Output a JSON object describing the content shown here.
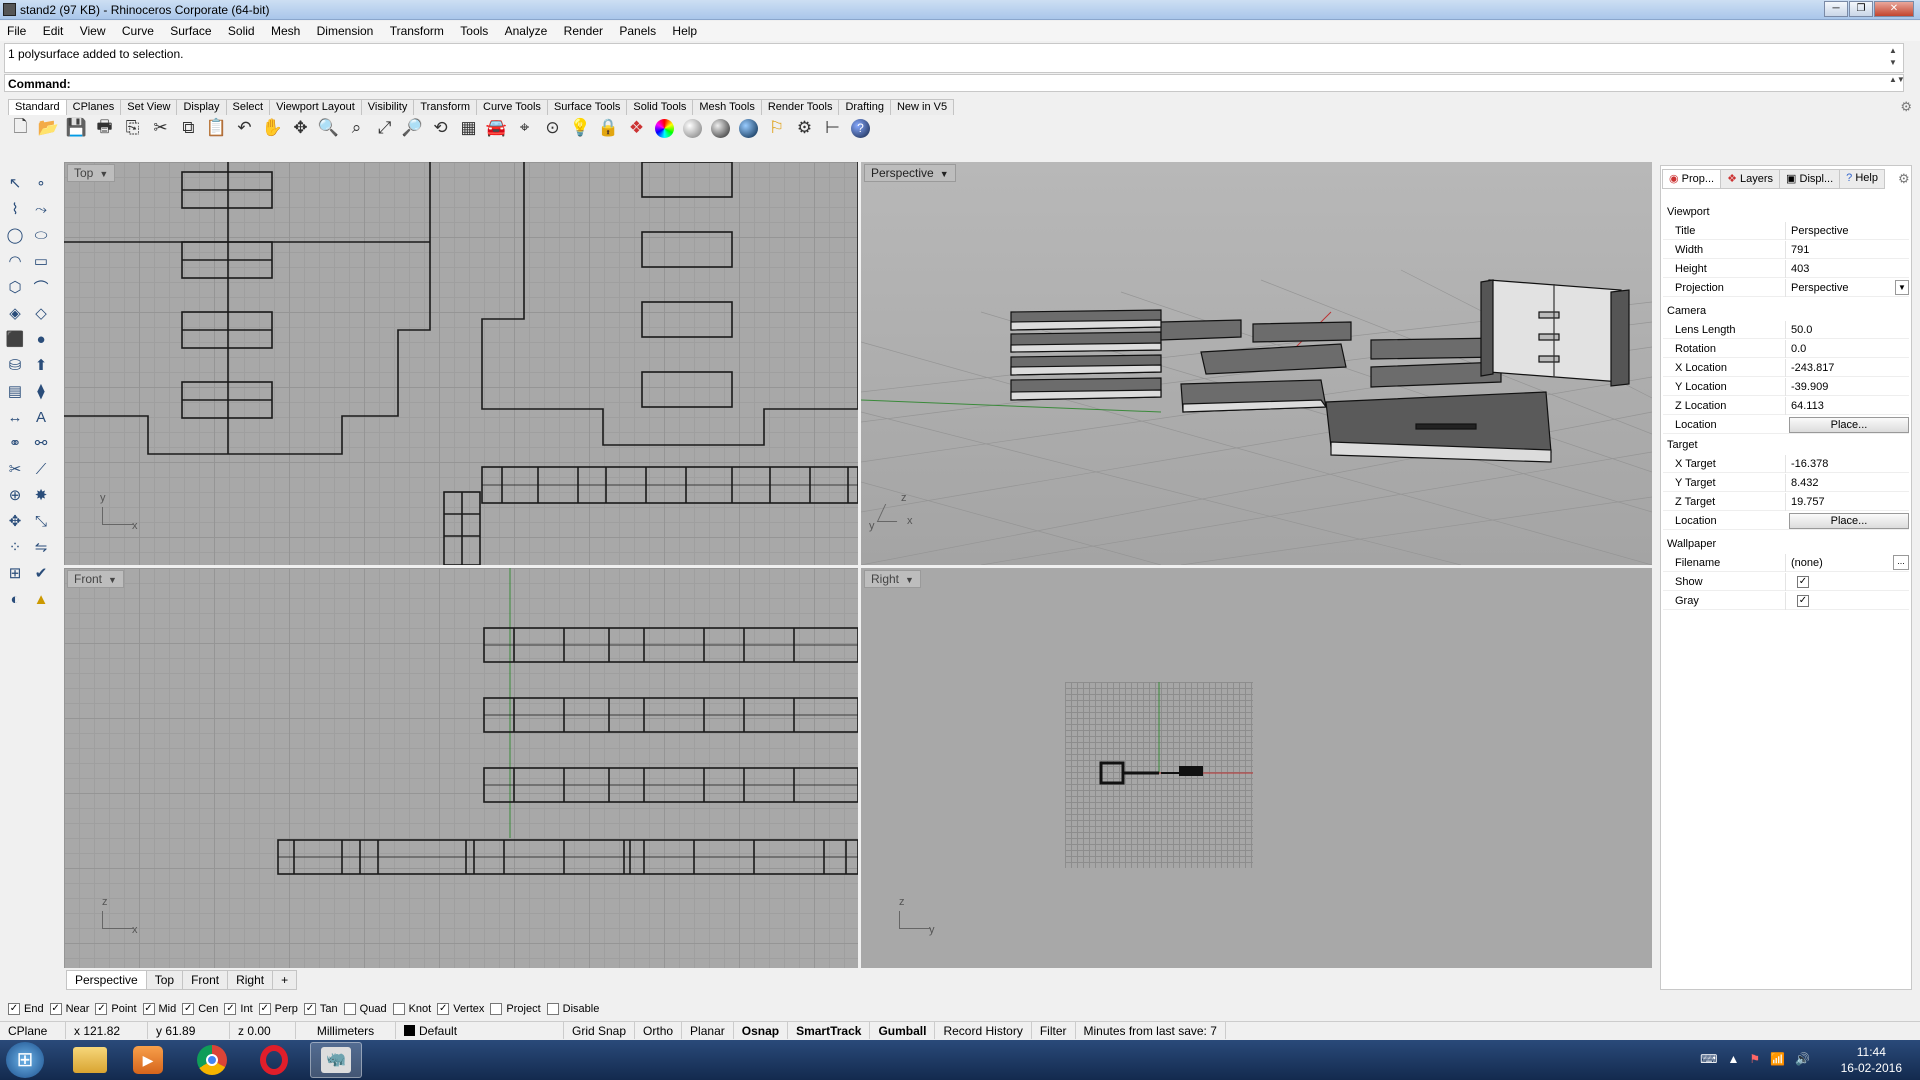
{
  "window": {
    "title": "stand2 (97 KB) - Rhinoceros Corporate (64-bit)",
    "buttons": [
      "─",
      "❐",
      "✕"
    ]
  },
  "menu": [
    "File",
    "Edit",
    "View",
    "Curve",
    "Surface",
    "Solid",
    "Mesh",
    "Dimension",
    "Transform",
    "Tools",
    "Analyze",
    "Render",
    "Panels",
    "Help"
  ],
  "history": {
    "text": "1 polysurface added to selection."
  },
  "command": {
    "label": "Command:"
  },
  "toolbar_tabs": [
    "Standard",
    "CPlanes",
    "Set View",
    "Display",
    "Select",
    "Viewport Layout",
    "Visibility",
    "Transform",
    "Curve Tools",
    "Surface Tools",
    "Solid Tools",
    "Mesh Tools",
    "Render Tools",
    "Drafting",
    "New in V5"
  ],
  "toolbar_icons": [
    "new-icon",
    "open-icon",
    "save-icon",
    "print-icon",
    "import-icon",
    "cut-icon",
    "copy-icon",
    "paste-icon",
    "undo-icon",
    "pan-icon",
    "move-icon",
    "zoom-icon",
    "zoom-window-icon",
    "zoom-extents-icon",
    "zoom-selected-icon",
    "rotate-view-icon",
    "four-view-icon",
    "car-icon",
    "cplane-icon",
    "point-icon",
    "light-icon",
    "lock-icon",
    "layer-icon",
    "color-wheel-icon",
    "shaded-sphere-icon",
    "rendered-sphere-icon",
    "render-sphere-icon",
    "filter-icon",
    "settings-icon",
    "dimension-icon",
    "help-icon"
  ],
  "viewports": {
    "top": {
      "title": "Top",
      "axis_x": "x",
      "axis_y": "y"
    },
    "perspective": {
      "title": "Perspective",
      "axis_x": "x",
      "axis_y": "y",
      "axis_z": "z"
    },
    "front": {
      "title": "Front",
      "axis_x": "x",
      "axis_z": "z"
    },
    "right": {
      "title": "Right",
      "axis_y": "y",
      "axis_z": "z"
    }
  },
  "viewport_tabs": [
    "Perspective",
    "Top",
    "Front",
    "Right",
    "+"
  ],
  "panel": {
    "tabs": [
      "Prop...",
      "Layers",
      "Displ...",
      "Help"
    ],
    "sections": {
      "viewport": "Viewport",
      "camera": "Camera",
      "target": "Target",
      "wallpaper": "Wallpaper"
    },
    "viewport_rows": [
      {
        "key": "Title",
        "value": "Perspective"
      },
      {
        "key": "Width",
        "value": "791"
      },
      {
        "key": "Height",
        "value": "403"
      },
      {
        "key": "Projection",
        "value": "Perspective"
      }
    ],
    "camera_rows": [
      {
        "key": "Lens Length",
        "value": "50.0"
      },
      {
        "key": "Rotation",
        "value": "0.0"
      },
      {
        "key": "X Location",
        "value": "-243.817"
      },
      {
        "key": "Y Location",
        "value": "-39.909"
      },
      {
        "key": "Z Location",
        "value": "64.113"
      }
    ],
    "camera_location": {
      "key": "Location",
      "button": "Place..."
    },
    "target_rows": [
      {
        "key": "X Target",
        "value": "-16.378"
      },
      {
        "key": "Y Target",
        "value": "8.432"
      },
      {
        "key": "Z Target",
        "value": "19.757"
      }
    ],
    "target_location": {
      "key": "Location",
      "button": "Place..."
    },
    "wallpaper_rows": [
      {
        "key": "Filename",
        "value": "(none)"
      },
      {
        "key": "Show",
        "checked": true
      },
      {
        "key": "Gray",
        "checked": true
      }
    ],
    "filename_button": "..."
  },
  "osnaps": [
    {
      "label": "End",
      "checked": true
    },
    {
      "label": "Near",
      "checked": true
    },
    {
      "label": "Point",
      "checked": true
    },
    {
      "label": "Mid",
      "checked": true
    },
    {
      "label": "Cen",
      "checked": true
    },
    {
      "label": "Int",
      "checked": true
    },
    {
      "label": "Perp",
      "checked": true
    },
    {
      "label": "Tan",
      "checked": true
    },
    {
      "label": "Quad",
      "checked": false
    },
    {
      "label": "Knot",
      "checked": false
    },
    {
      "label": "Vertex",
      "checked": true
    },
    {
      "label": "Project",
      "checked": false
    },
    {
      "label": "Disable",
      "checked": false
    }
  ],
  "status": {
    "cplane": "CPlane",
    "x": "x 121.82",
    "y": "y 61.89",
    "z": "z 0.00",
    "units": "Millimeters",
    "layer": "Default",
    "grid_snap": "Grid Snap",
    "ortho": "Ortho",
    "planar": "Planar",
    "osnap": "Osnap",
    "smarttrack": "SmartTrack",
    "gumball": "Gumball",
    "record_history": "Record History",
    "filter": "Filter",
    "save_info": "Minutes from last save: 7"
  },
  "taskbar": {
    "time": "11:44",
    "date": "16-02-2016"
  }
}
